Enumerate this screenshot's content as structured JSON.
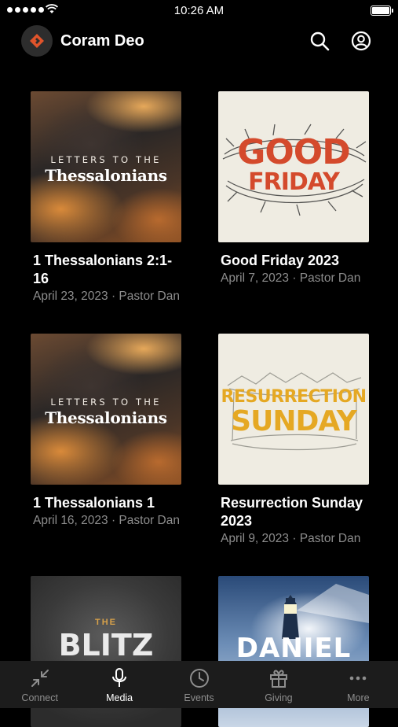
{
  "status_bar": {
    "time": "10:26 AM"
  },
  "header": {
    "title": "Coram Deo"
  },
  "items": [
    {
      "title": "1 Thessalonians 2:1-16",
      "subtitle": "April 23, 2023 · Pastor Dan",
      "art": {
        "line1": "LETTERS TO THE",
        "line2": "Thessalonians"
      }
    },
    {
      "title": "Good Friday 2023",
      "subtitle": "April 7, 2023 · Pastor Dan",
      "art": {
        "line1": "GOOD",
        "line2": "FRIDAY"
      }
    },
    {
      "title": "1 Thessalonians 1",
      "subtitle": "April 16, 2023 · Pastor Dan",
      "art": {
        "line1": "LETTERS TO THE",
        "line2": "Thessalonians"
      }
    },
    {
      "title": "Resurrection Sunday 2023",
      "subtitle": "April 9, 2023 · Pastor Dan",
      "art": {
        "line1": "RESURRECTION",
        "line2": "SUNDAY"
      }
    },
    {
      "art": {
        "line1": "THE",
        "line2": "BLITZ"
      }
    },
    {
      "art": {
        "line1": "DANIEL"
      }
    }
  ],
  "tabs": [
    {
      "label": "Connect",
      "icon": "arrows-in-icon",
      "active": false
    },
    {
      "label": "Media",
      "icon": "microphone-icon",
      "active": true
    },
    {
      "label": "Events",
      "icon": "clock-icon",
      "active": false
    },
    {
      "label": "Giving",
      "icon": "gift-icon",
      "active": false
    },
    {
      "label": "More",
      "icon": "ellipsis-icon",
      "active": false
    }
  ],
  "colors": {
    "background": "#000000",
    "tab_bar": "#1c1c1c",
    "logo_accent": "#e0542b",
    "muted_text": "#8d8d8d"
  }
}
